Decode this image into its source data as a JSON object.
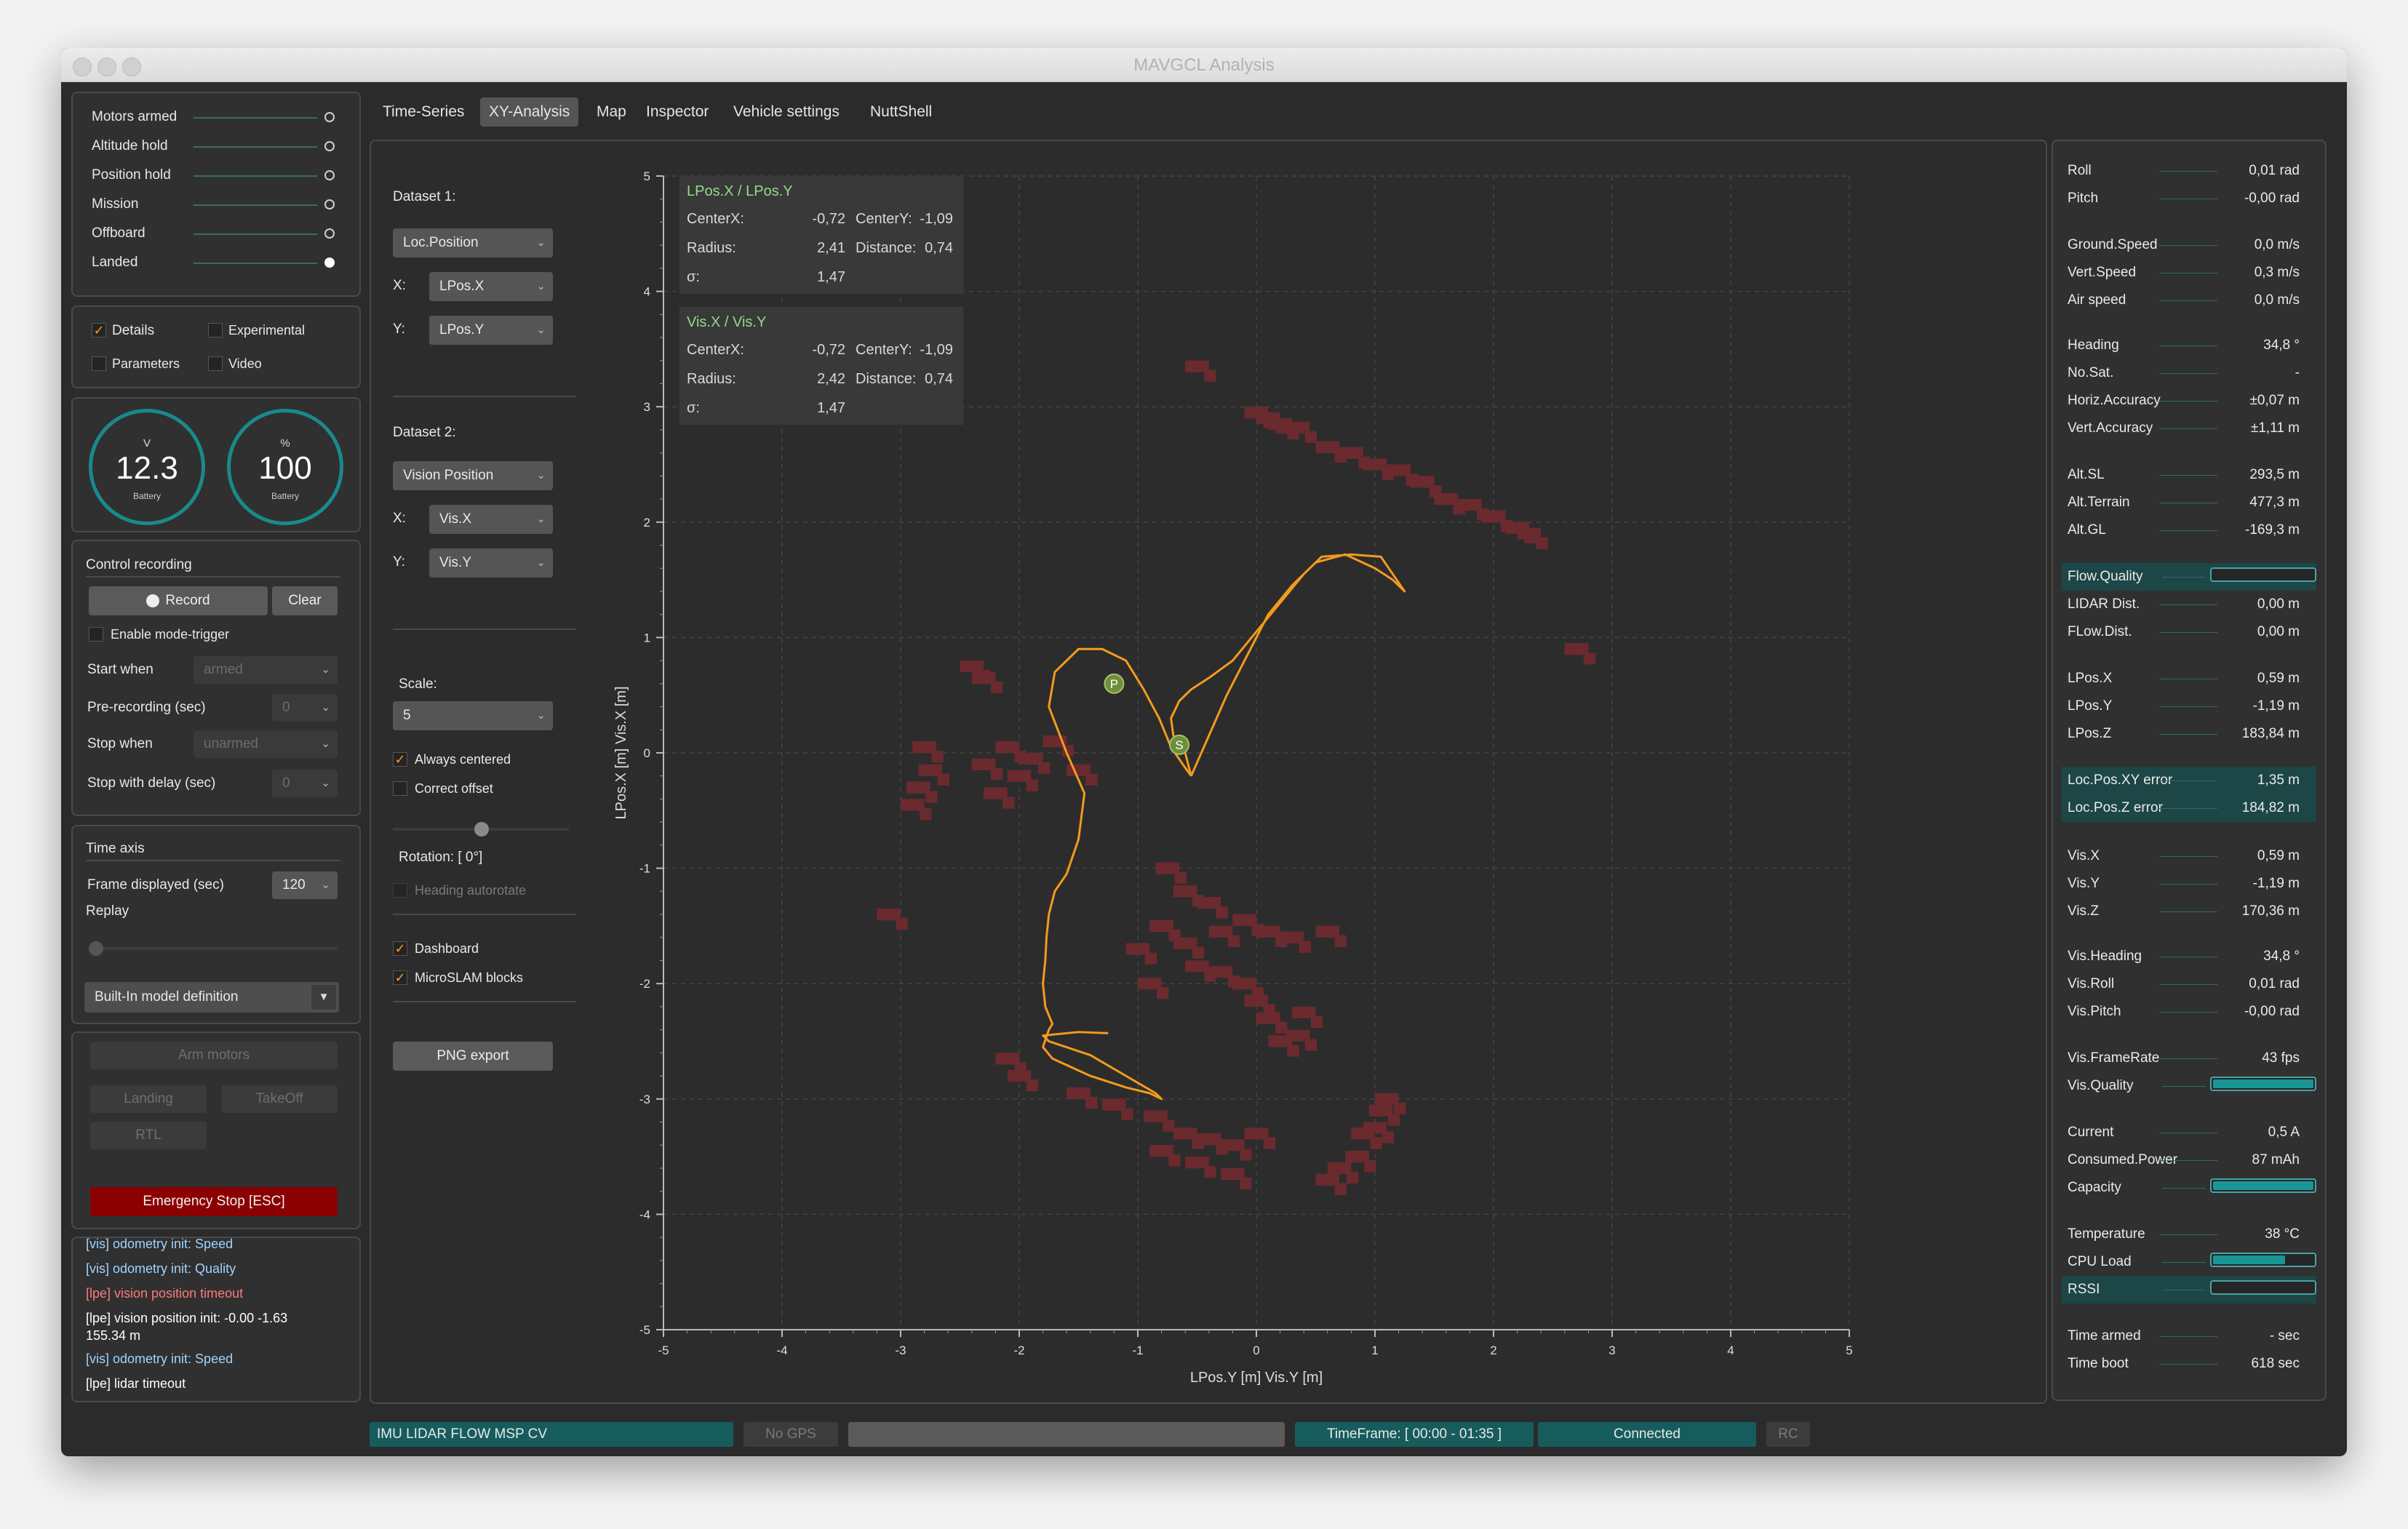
{
  "window": {
    "title": "MAVGCL Analysis"
  },
  "modes": [
    {
      "label": "Motors armed",
      "active": false
    },
    {
      "label": "Altitude hold",
      "active": false
    },
    {
      "label": "Position hold",
      "active": false
    },
    {
      "label": "Mission",
      "active": false
    },
    {
      "label": "Offboard",
      "active": false
    },
    {
      "label": "Landed",
      "active": true
    }
  ],
  "view_options": {
    "details": "Details",
    "experimental": "Experimental",
    "parameters": "Parameters",
    "video": "Video"
  },
  "gauges": [
    {
      "unit": "V",
      "value": "12.3",
      "label": "Battery"
    },
    {
      "unit": "%",
      "value": "100",
      "label": "Battery"
    }
  ],
  "recording": {
    "title": "Control recording",
    "record": "Record",
    "clear": "Clear",
    "mode_trigger": "Enable mode-trigger",
    "start_when": "Start when",
    "start_when_value": "armed",
    "pre_recording": "Pre-recording (sec)",
    "pre_recording_value": "0",
    "stop_when": "Stop when",
    "stop_when_value": "unarmed",
    "stop_delay": "Stop with delay (sec)",
    "stop_delay_value": "0"
  },
  "time_axis": {
    "title": "Time axis",
    "frame_label": "Frame displayed (sec)",
    "frame_value": "120",
    "replay": "Replay",
    "model": "Built-In model definition"
  },
  "commands": {
    "arm": "Arm motors",
    "landing": "Landing",
    "takeoff": "TakeOff",
    "rtl": "RTL",
    "emergency": "Emergency Stop [ESC]"
  },
  "log": [
    {
      "text": "[vis] odometry init: Speed",
      "color": "#9fd3ff"
    },
    {
      "text": "[vis] odometry init: Quality",
      "color": "#9fd3ff"
    },
    {
      "text": "[lpe] vision position timeout",
      "color": "#ff7a7a"
    },
    {
      "text": "[lpe] vision position init: -0.00 -1.63",
      "color": "#ffffff"
    },
    {
      "text": "155.34 m",
      "color": "#ffffff"
    },
    {
      "text": "[vis] odometry init: Speed",
      "color": "#9fd3ff"
    },
    {
      "text": "[lpe] lidar timeout",
      "color": "#ffffff"
    }
  ],
  "tabs": [
    "Time-Series",
    "XY-Analysis",
    "Map",
    "Inspector",
    "Vehicle settings",
    "NuttShell"
  ],
  "active_tab": "XY-Analysis",
  "analysis": {
    "dataset1": "Dataset 1:",
    "dataset1_value": "Loc.Position",
    "x": "X:",
    "y": "Y:",
    "ds1_x": "LPos.X",
    "ds1_y": "LPos.Y",
    "dataset2": "Dataset 2:",
    "dataset2_value": "Vision Position",
    "ds2_x": "Vis.X",
    "ds2_y": "Vis.Y",
    "scale": "Scale:",
    "scale_value": "5",
    "always_centered": "Always centered",
    "correct_offset": "Correct offset",
    "rotation": "Rotation: [ 0°]",
    "heading_autorotate": "Heading autorotate",
    "dashboard": "Dashboard",
    "microslam": "MicroSLAM blocks",
    "png_export": "PNG export"
  },
  "chart_data": {
    "type": "scatter",
    "xlabel": "LPos.Y [m] Vis.Y [m]",
    "ylabel": "LPos.X [m] Vis.X [m]",
    "xlim": [
      -5,
      5
    ],
    "ylim": [
      -5,
      5
    ],
    "xticks": [
      "-5",
      "-4",
      "-3",
      "-2",
      "-1",
      "0",
      "1",
      "2",
      "3",
      "4",
      "5"
    ],
    "yticks": [
      "5",
      "4",
      "3",
      "2",
      "1",
      "0",
      "-1",
      "-2",
      "-3",
      "-4",
      "-5"
    ],
    "grid": true,
    "series": [
      {
        "name": "LPos.X / LPos.Y",
        "color": "#f39a1e",
        "x": [
          -0.55,
          -0.62,
          -0.72,
          -0.82,
          -0.95,
          -1.1,
          -1.3,
          -1.5,
          -1.7,
          -1.75,
          -1.6,
          -1.45,
          -1.5,
          -1.6,
          -1.7,
          -1.75,
          -1.77,
          -1.78,
          -1.8,
          -1.78,
          -1.72,
          -1.75,
          -1.8,
          -1.72,
          -1.4,
          -1.1,
          -0.9,
          -0.8,
          -0.85,
          -1.1,
          -1.4,
          -1.75,
          -1.8,
          -1.5,
          -1.25
        ],
        "y": [
          -0.2,
          -0.1,
          0.05,
          0.3,
          0.55,
          0.8,
          0.9,
          0.9,
          0.7,
          0.4,
          0.0,
          -0.35,
          -0.75,
          -1.05,
          -1.2,
          -1.4,
          -1.6,
          -1.8,
          -2.0,
          -2.2,
          -2.35,
          -2.4,
          -2.55,
          -2.65,
          -2.8,
          -2.9,
          -2.95,
          -3.0,
          -2.95,
          -2.8,
          -2.62,
          -2.5,
          -2.45,
          -2.42,
          -2.43
        ]
      },
      {
        "name": "Vis.X / Vis.Y",
        "color": "#f39a1e",
        "x": [
          -0.55,
          -0.4,
          -0.25,
          -0.05,
          0.1,
          0.3,
          0.5,
          0.75,
          1.0,
          1.15,
          1.25,
          1.05,
          0.8,
          0.55,
          0.4,
          0.2,
          0.0,
          -0.2,
          -0.4,
          -0.55,
          -0.65,
          -0.72,
          -0.7,
          -0.6,
          -0.55
        ],
        "y": [
          -0.2,
          0.15,
          0.5,
          0.9,
          1.2,
          1.45,
          1.65,
          1.72,
          1.6,
          1.5,
          1.4,
          1.7,
          1.72,
          1.7,
          1.55,
          1.3,
          1.05,
          0.8,
          0.65,
          0.55,
          0.45,
          0.3,
          0.15,
          0.0,
          -0.2
        ]
      }
    ],
    "markers": [
      {
        "label": "P",
        "x": -1.2,
        "y": 0.6
      },
      {
        "label": "S",
        "x": -0.65,
        "y": 0.07
      }
    ],
    "microslam_blocks": [
      [
        0.0,
        2.95
      ],
      [
        0.1,
        2.9
      ],
      [
        0.2,
        2.85
      ],
      [
        0.35,
        2.82
      ],
      [
        0.6,
        2.65
      ],
      [
        0.8,
        2.6
      ],
      [
        1.0,
        2.5
      ],
      [
        1.2,
        2.45
      ],
      [
        1.4,
        2.35
      ],
      [
        1.6,
        2.2
      ],
      [
        1.8,
        2.15
      ],
      [
        2.0,
        2.05
      ],
      [
        2.2,
        1.95
      ],
      [
        2.3,
        1.9
      ],
      [
        -0.5,
        3.35
      ],
      [
        2.7,
        0.9
      ],
      [
        -2.4,
        0.75
      ],
      [
        -2.3,
        0.65
      ],
      [
        -2.8,
        0.05
      ],
      [
        -2.75,
        -0.15
      ],
      [
        -2.85,
        -0.3
      ],
      [
        -2.9,
        -0.45
      ],
      [
        -2.3,
        -0.1
      ],
      [
        -2.1,
        0.05
      ],
      [
        -2.0,
        -0.2
      ],
      [
        -2.2,
        -0.35
      ],
      [
        -1.9,
        -0.05
      ],
      [
        -1.7,
        0.1
      ],
      [
        -1.5,
        -0.15
      ],
      [
        -3.1,
        -1.4
      ],
      [
        -0.75,
        -1.0
      ],
      [
        -0.6,
        -1.2
      ],
      [
        -0.4,
        -1.3
      ],
      [
        -0.8,
        -1.5
      ],
      [
        -0.6,
        -1.65
      ],
      [
        -0.3,
        -1.55
      ],
      [
        -0.1,
        -1.45
      ],
      [
        0.1,
        -1.55
      ],
      [
        0.3,
        -1.6
      ],
      [
        0.6,
        -1.55
      ],
      [
        -0.5,
        -1.85
      ],
      [
        -0.3,
        -1.9
      ],
      [
        -0.1,
        -2.0
      ],
      [
        0.0,
        -2.15
      ],
      [
        0.1,
        -2.3
      ],
      [
        0.2,
        -2.5
      ],
      [
        0.4,
        -2.25
      ],
      [
        0.35,
        -2.45
      ],
      [
        -1.0,
        -1.7
      ],
      [
        -0.9,
        -2.0
      ],
      [
        -2.1,
        -2.65
      ],
      [
        -2.0,
        -2.8
      ],
      [
        -1.5,
        -2.95
      ],
      [
        -1.2,
        -3.05
      ],
      [
        -0.85,
        -3.15
      ],
      [
        -0.6,
        -3.3
      ],
      [
        -0.4,
        -3.35
      ],
      [
        -0.2,
        -3.4
      ],
      [
        0.0,
        -3.3
      ],
      [
        -0.8,
        -3.45
      ],
      [
        -0.5,
        -3.55
      ],
      [
        -0.2,
        -3.65
      ],
      [
        0.6,
        -3.7
      ],
      [
        0.9,
        -3.3
      ],
      [
        1.05,
        -3.1
      ],
      [
        1.1,
        -3.0
      ],
      [
        1.0,
        -3.25
      ],
      [
        0.85,
        -3.5
      ],
      [
        0.7,
        -3.6
      ]
    ]
  },
  "info_boxes": [
    {
      "title": "LPos.X / LPos.Y",
      "centerx_label": "CenterX:",
      "centerx": "-0,72",
      "centery_label": "CenterY:",
      "centery": "-1,09",
      "radius_label": "Radius:",
      "radius": "2,41",
      "distance_label": "Distance:",
      "distance": "0,74",
      "sigma_label": "σ:",
      "sigma": "1,47"
    },
    {
      "title": "Vis.X / Vis.Y",
      "centerx_label": "CenterX:",
      "centerx": "-0,72",
      "centery_label": "CenterY:",
      "centery": "-1,09",
      "radius_label": "Radius:",
      "radius": "2,42",
      "distance_label": "Distance:",
      "distance": "0,74",
      "sigma_label": "σ:",
      "sigma": "1,47"
    }
  ],
  "telemetry": [
    {
      "name": "Roll",
      "value": "0,01 rad"
    },
    {
      "name": "Pitch",
      "value": "-0,00 rad"
    },
    {
      "name": "Ground.Speed",
      "value": "0,0 m/s"
    },
    {
      "name": "Vert.Speed",
      "value": "0,3 m/s"
    },
    {
      "name": "Air speed",
      "value": "0,0 m/s"
    },
    {
      "name": "Heading",
      "value": "34,8 °"
    },
    {
      "name": "No.Sat.",
      "value": "-"
    },
    {
      "name": "Horiz.Accuracy",
      "value": "±0,07 m"
    },
    {
      "name": "Vert.Accuracy",
      "value": "±1,11 m"
    },
    {
      "name": "Alt.SL",
      "value": "293,5 m"
    },
    {
      "name": "Alt.Terrain",
      "value": "477,3 m"
    },
    {
      "name": "Alt.GL",
      "value": "-169,3 m"
    },
    {
      "name": "Flow.Quality",
      "bar": 0.0
    },
    {
      "name": "LIDAR Dist.",
      "value": "0,00 m"
    },
    {
      "name": "FLow.Dist.",
      "value": "0,00 m"
    },
    {
      "name": "LPos.X",
      "value": "0,59 m"
    },
    {
      "name": "LPos.Y",
      "value": "-1,19 m"
    },
    {
      "name": "LPos.Z",
      "value": "183,84 m"
    },
    {
      "name": "Loc.Pos.XY error",
      "value": "1,35 m"
    },
    {
      "name": "Loc.Pos.Z error",
      "value": "184,82 m"
    },
    {
      "name": "Vis.X",
      "value": "0,59 m"
    },
    {
      "name": "Vis.Y",
      "value": "-1,19 m"
    },
    {
      "name": "Vis.Z",
      "value": "170,36 m"
    },
    {
      "name": "Vis.Heading",
      "value": "34,8 °"
    },
    {
      "name": "Vis.Roll",
      "value": "0,01 rad"
    },
    {
      "name": "Vis.Pitch",
      "value": "-0,00 rad"
    },
    {
      "name": "Vis.FrameRate",
      "value": "43 fps"
    },
    {
      "name": "Vis.Quality",
      "bar": 1.0
    },
    {
      "name": "Current",
      "value": "0,5 A"
    },
    {
      "name": "Consumed.Power",
      "value": "87 mAh"
    },
    {
      "name": "Capacity",
      "bar": 1.0
    },
    {
      "name": "Temperature",
      "value": "38 °C"
    },
    {
      "name": "CPU Load",
      "bar": 0.72
    },
    {
      "name": "RSSI",
      "bar": 0.0
    },
    {
      "name": "Time armed",
      "value": "- sec"
    },
    {
      "name": "Time boot",
      "value": "618 sec"
    }
  ],
  "statusbar": {
    "sensors": "IMU LIDAR FLOW MSP CV",
    "gps": "No GPS",
    "timeframe": "TimeFrame: [ 00:00 - 01:35 ]",
    "connection": "Connected",
    "rc": "RC"
  },
  "colors": {
    "accent": "#1a8a8a",
    "trajectory": "#f39a1e",
    "slam": "#6b2a2e",
    "emergency": "#8b0000"
  }
}
